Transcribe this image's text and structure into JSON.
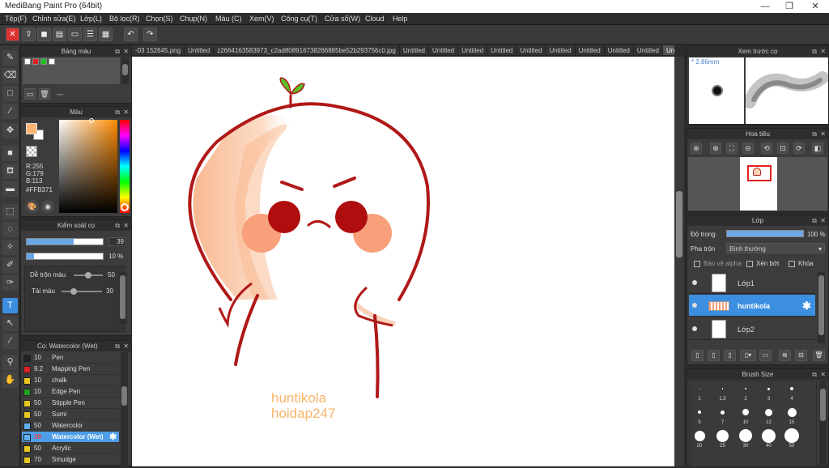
{
  "title_bar": {
    "title": "MediBang Paint Pro (64bit)",
    "minimize": "—",
    "maximize": "❐",
    "close": "✕"
  },
  "menu": [
    "Tệp(F)",
    "Chỉnh sửa(E)",
    "Lớp(L)",
    "Bộ lọc(R)",
    "Chọn(S)",
    "Chụp(N)",
    "Màu (C)",
    "Xem(V)",
    "Công cụ(T)",
    "Cửa sổ(W)",
    "Cloud",
    "Help"
  ],
  "tabs": [
    "-03 152645.png",
    "Untitled",
    "z2664163583973_c2ad808916738266885be52b293756c0.jpg",
    "Untitled",
    "Untitled",
    "Untitled",
    "Untitled",
    "Untitled",
    "Untitled",
    "Untitled",
    "Untitled",
    "Untitled",
    "Untitled"
  ],
  "palette_panel": {
    "title": "Bảng màu",
    "extra": "---",
    "swatches": [
      "#ffffff",
      "#e02020",
      "#20c020",
      "#ffffff"
    ]
  },
  "color_panel": {
    "title": "Màu",
    "r": "R:255",
    "g": "G:179",
    "b": "B:113",
    "hex": "#FFB371",
    "fg": "#ffb371",
    "bg": "#ffffff"
  },
  "brush_control": {
    "title": "Kiểm soát cọ",
    "size_value": "39",
    "opacity_value": "10 %",
    "size_fraction": 0.62,
    "opacity_fraction": 0.1,
    "blend_label": "Dễ trộn màu",
    "blend_value": "50",
    "blend_fraction": 0.5,
    "amount_label": "Tải màu",
    "amount_value": "30",
    "amount_fraction": 0.3
  },
  "brush_panel": {
    "title": "Cọ: Watercolor (Wet)",
    "items": [
      {
        "num": "10",
        "name": "Pen",
        "color": "#222222"
      },
      {
        "num": "9.2",
        "name": "Mapping Pen",
        "color": "#e02020"
      },
      {
        "num": "10",
        "name": "chalk",
        "color": "#e8c820"
      },
      {
        "num": "10",
        "name": "Edge Pen",
        "color": "#20a020"
      },
      {
        "num": "50",
        "name": "Stipple Pen",
        "color": "#e8c820"
      },
      {
        "num": "50",
        "name": "Sumi",
        "color": "#e8c820"
      },
      {
        "num": "50",
        "name": "Watercolor",
        "color": "#60b0f0"
      },
      {
        "num": "39",
        "name": "Watercolor (Wet)",
        "color": "#60b0f0"
      },
      {
        "num": "50",
        "name": "Acrylic",
        "color": "#e8c820"
      },
      {
        "num": "70",
        "name": "Smudge",
        "color": "#e8c820"
      }
    ]
  },
  "canvas": {
    "watermark_line1": "huntikola",
    "watermark_line2": "hoidap247"
  },
  "preview_panel": {
    "title": "Xem trước cọ",
    "size_label": "* 2.86mm"
  },
  "navigator_panel": {
    "title": "Hoa tiêu"
  },
  "layer_panel": {
    "title": "Lớp",
    "opacity_label": "Độ trong",
    "opacity_value": "100 %",
    "opacity_fraction": 1.0,
    "blend_label": "Pha trộn",
    "blend_value": "Bình thường",
    "protect_alpha": "Bảo vệ alpha",
    "clipping": "Xén bớt",
    "lock": "Khóa",
    "layers": [
      "Lớp1",
      "huntikola",
      "Lớp2"
    ]
  },
  "brush_size_panel": {
    "title": "Brush Size",
    "row1": [
      "1",
      "1.5",
      "2",
      "3",
      "4"
    ],
    "row2": [
      "5",
      "7",
      "10",
      "12",
      "15"
    ],
    "row3": [
      "20",
      "25",
      "30",
      "40",
      "50"
    ]
  },
  "colors": {
    "accent": "#3c8ee0",
    "outline": "#b01818",
    "blush": "#f7a07a",
    "cheek_dark": "#b00e0e",
    "sprout": "#5bbf2a",
    "watermark": "#f6b46a"
  }
}
